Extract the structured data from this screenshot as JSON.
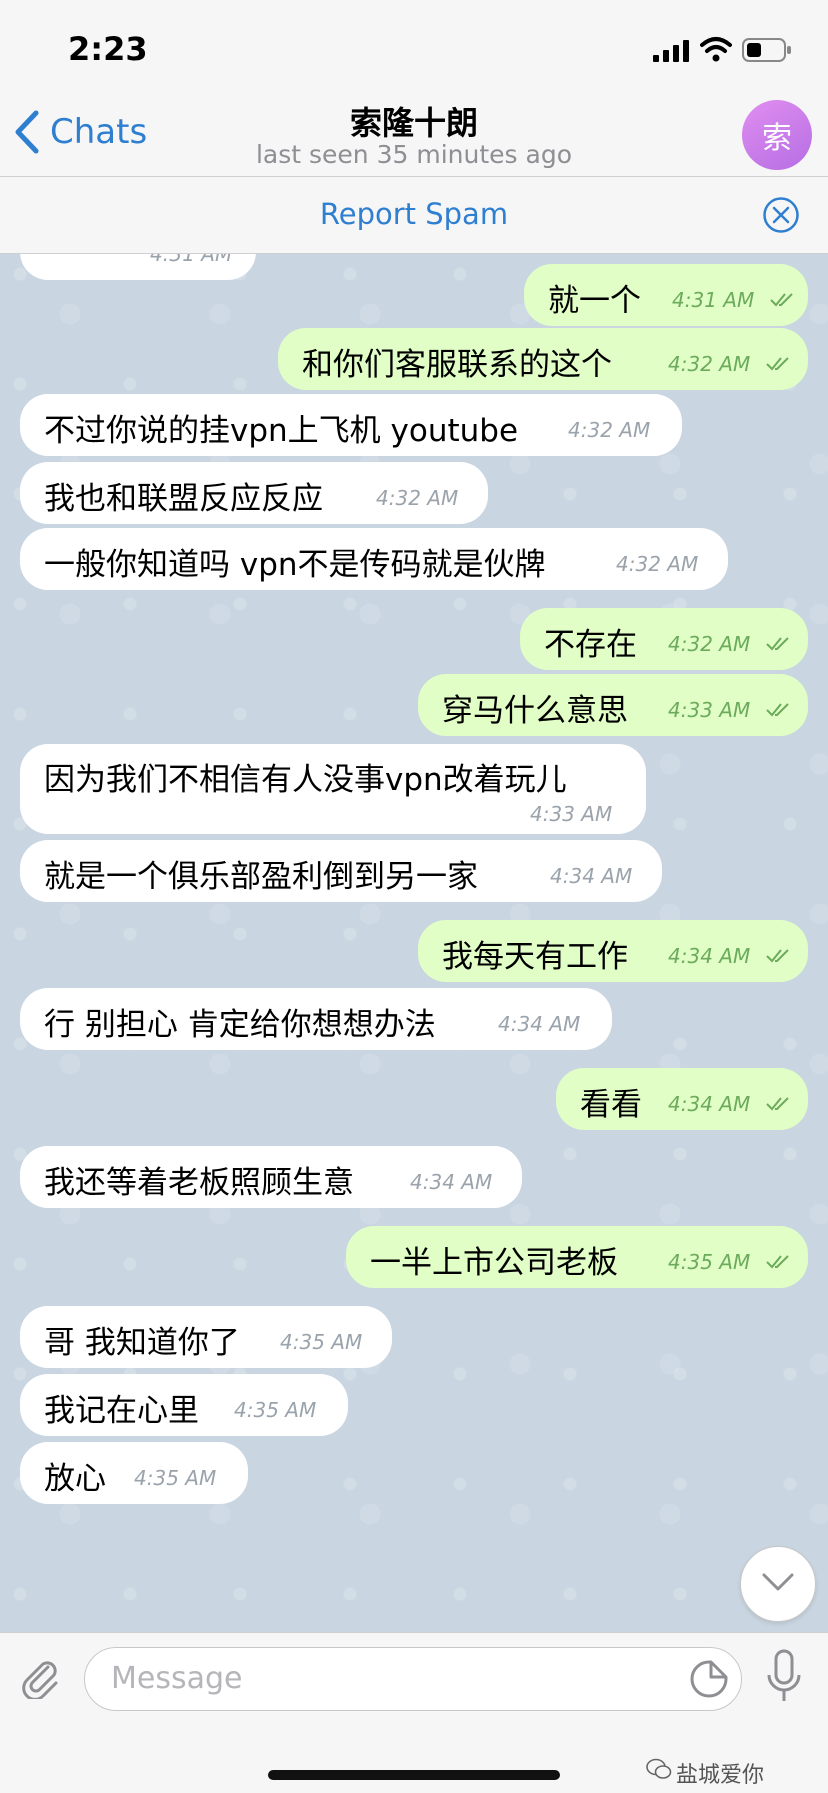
{
  "status": {
    "time": "2:23"
  },
  "nav": {
    "back_label": "Chats",
    "title": "索隆十朗",
    "subtitle": "last seen 35 minutes ago",
    "avatar_letter": "索"
  },
  "report_spam": {
    "label": "Report Spam"
  },
  "messages": [
    {
      "dir": "in",
      "text": "",
      "time": "4:31 AM"
    },
    {
      "dir": "out",
      "text": "就一个",
      "time": "4:31 AM"
    },
    {
      "dir": "out",
      "text": "和你们客服联系的这个",
      "time": "4:32 AM"
    },
    {
      "dir": "in",
      "text": "不过你说的挂vpn上飞机 youtube",
      "time": "4:32 AM"
    },
    {
      "dir": "in",
      "text": "我也和联盟反应反应",
      "time": "4:32 AM"
    },
    {
      "dir": "in",
      "text": "一般你知道吗 vpn不是传码就是伙牌",
      "time": "4:32 AM"
    },
    {
      "dir": "out",
      "text": "不存在",
      "time": "4:32 AM"
    },
    {
      "dir": "out",
      "text": "穿马什么意思",
      "time": "4:33 AM"
    },
    {
      "dir": "in",
      "text": "因为我们不相信有人没事vpn改着玩儿",
      "time": "4:33 AM"
    },
    {
      "dir": "in",
      "text": "就是一个俱乐部盈利倒到另一家",
      "time": "4:34 AM"
    },
    {
      "dir": "out",
      "text": "我每天有工作",
      "time": "4:34 AM"
    },
    {
      "dir": "in",
      "text": "行 别担心 肯定给你想想办法",
      "time": "4:34 AM"
    },
    {
      "dir": "out",
      "text": "看看",
      "time": "4:34 AM"
    },
    {
      "dir": "in",
      "text": "我还等着老板照顾生意",
      "time": "4:34 AM"
    },
    {
      "dir": "out",
      "text": "一半上市公司老板",
      "time": "4:35 AM"
    },
    {
      "dir": "in",
      "text": "哥 我知道你了",
      "time": "4:35 AM"
    },
    {
      "dir": "in",
      "text": "我记在心里",
      "time": "4:35 AM"
    },
    {
      "dir": "in",
      "text": "放心",
      "time": "4:35 AM"
    }
  ],
  "input": {
    "placeholder": "Message"
  },
  "watermark": "盐城爱你",
  "icons": {
    "back": "chevron-left-icon",
    "close": "close-circle-icon",
    "attach": "paperclip-icon",
    "sticker": "sticker-icon",
    "mic": "microphone-icon",
    "scroll": "chevron-down-icon",
    "read": "double-check-icon"
  },
  "colors": {
    "accent": "#2f7fd0",
    "outgoing_bubble": "#e1fec6",
    "incoming_bubble": "#ffffff",
    "avatar": "#c77ee8"
  }
}
